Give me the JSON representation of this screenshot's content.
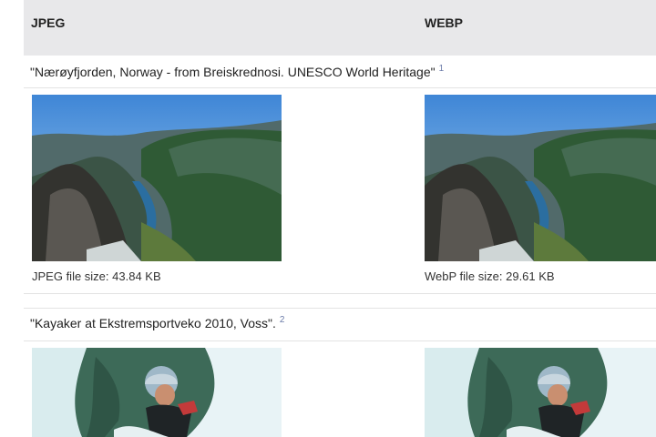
{
  "table": {
    "headers": {
      "jpeg": "JPEG",
      "webp": "WEBP"
    },
    "rows": [
      {
        "caption": "\"Nærøyfjorden, Norway - from Breiskrednosi. UNESCO World Heritage\"",
        "ref": "1",
        "jpeg_size": "JPEG file size: 43.84 KB",
        "webp_size": "WebP file size: 29.61 KB"
      },
      {
        "caption": "\"Kayaker at Ekstremsportveko 2010, Voss\".",
        "ref": "2"
      }
    ]
  },
  "icons": [
    "fjorden-photo",
    "kayaker-photo"
  ]
}
